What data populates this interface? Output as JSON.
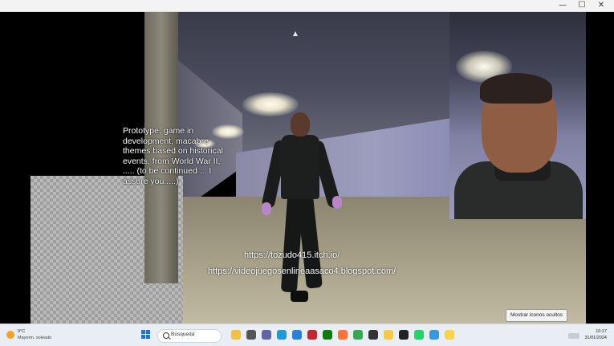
{
  "window": {
    "minimize_glyph": "—",
    "maximize_glyph": "☐",
    "close_glyph": "✕"
  },
  "overlay": {
    "description": "Prototype, game in development, macabre themes based on historical events, from World War II, ..... (to be continued ... I assure you.....)",
    "url_itch": "https://tozudo415.itch.io/",
    "url_blog": "https://videojuegosenlineaasaco4.blogspot.com/",
    "button_label": "Mostrar iconos ocultos"
  },
  "taskbar": {
    "weather_temp": "9°C",
    "weather_desc": "Mayorm. soleado",
    "search_placeholder": "Búsqueda",
    "time": "10:17",
    "date": "31/01/2024",
    "apps": [
      {
        "name": "file-explorer-icon",
        "color": "#f2c144"
      },
      {
        "name": "files-icon",
        "color": "#555555"
      },
      {
        "name": "teams-icon",
        "color": "#6264a7"
      },
      {
        "name": "edge-icon",
        "color": "#1f9ad6"
      },
      {
        "name": "store-icon",
        "color": "#2b7fd8"
      },
      {
        "name": "red-app-icon",
        "color": "#c2262e"
      },
      {
        "name": "xbox-icon",
        "color": "#107c10"
      },
      {
        "name": "firefox-icon",
        "color": "#ff7139"
      },
      {
        "name": "chrome-icon",
        "color": "#34a853"
      },
      {
        "name": "github-icon",
        "color": "#333333"
      },
      {
        "name": "folder-icon",
        "color": "#f7c948"
      },
      {
        "name": "terminal-icon",
        "color": "#222222"
      },
      {
        "name": "whatsapp-icon",
        "color": "#25d366"
      },
      {
        "name": "photos-icon",
        "color": "#3a96dd"
      },
      {
        "name": "notes-icon",
        "color": "#f8d44c"
      }
    ]
  }
}
